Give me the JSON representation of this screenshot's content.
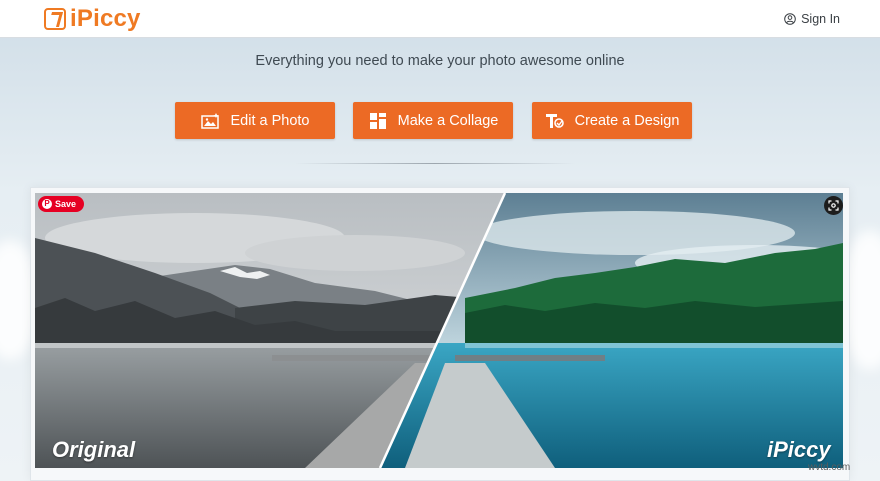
{
  "header": {
    "logo_text": "iPiccy",
    "signin_label": "Sign In",
    "signin_icon": "user-icon"
  },
  "hero": {
    "subtitle": "Everything you need to make your photo awesome online"
  },
  "actions": {
    "edit_label": "Edit a Photo",
    "edit_icon": "photo-edit-icon",
    "collage_label": "Make a Collage",
    "collage_icon": "collage-grid-icon",
    "design_label": "Create a Design",
    "design_icon": "design-text-icon"
  },
  "showcase": {
    "save_label": "Save",
    "left_label": "Original",
    "right_label": "iPiccy",
    "lens_icon": "lens-icon"
  },
  "watermark": "wvtd.com",
  "colors": {
    "brand": "#ef7a23",
    "button": "#ec6a25",
    "pinterest": "#e60023"
  }
}
